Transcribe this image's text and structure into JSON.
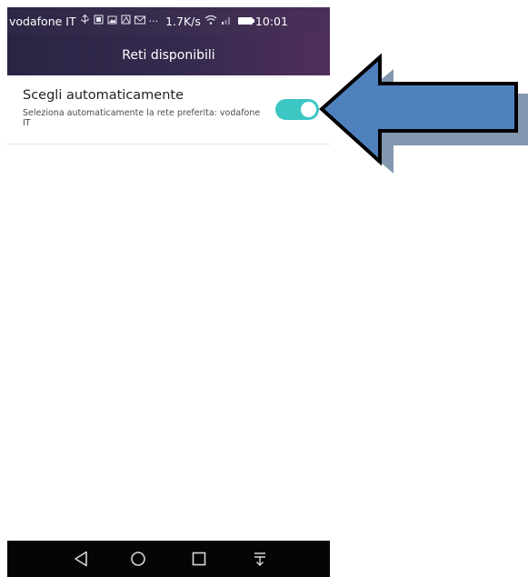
{
  "statusbar": {
    "carrier": "vodafone IT",
    "speed": "1.7K/s",
    "time": "10:01",
    "more": "···",
    "icons": [
      "usb-icon",
      "screenshot-icon",
      "gallery-icon",
      "image-icon",
      "mail-icon",
      "wifi-icon",
      "signal-icon",
      "battery-icon"
    ]
  },
  "header": {
    "title": "Reti disponibili"
  },
  "setting": {
    "title": "Scegli automaticamente",
    "description": "Seleziona automaticamente la rete preferita: vodafone IT",
    "toggle_on": true
  },
  "navbar": {
    "buttons": [
      "back-icon",
      "home-icon",
      "recents-icon",
      "notification-pull-icon"
    ]
  },
  "colors": {
    "header_bg": "#3a2d50",
    "toggle_on": "#3cc6c4",
    "arrow_fill": "#4f81bd",
    "arrow_shadow": "#8497b0"
  }
}
